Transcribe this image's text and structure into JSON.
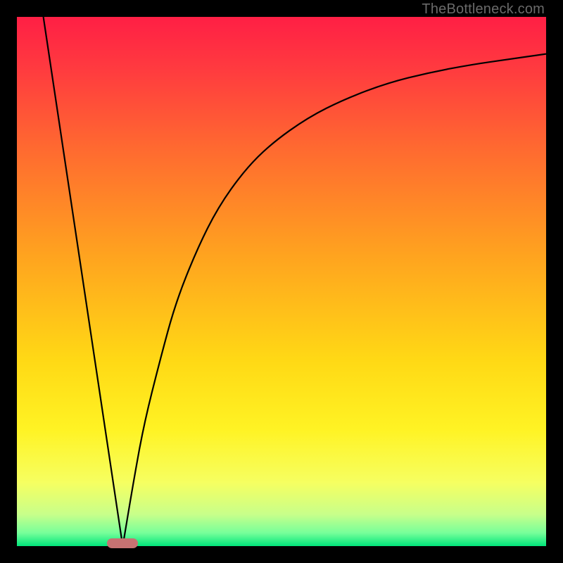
{
  "watermark": "TheBottleneck.com",
  "colors": {
    "frame": "#000000",
    "gradient_stops": [
      {
        "offset": 0.0,
        "color": "#ff1f45"
      },
      {
        "offset": 0.1,
        "color": "#ff3b3f"
      },
      {
        "offset": 0.25,
        "color": "#ff6a30"
      },
      {
        "offset": 0.45,
        "color": "#ffa31f"
      },
      {
        "offset": 0.65,
        "color": "#ffd915"
      },
      {
        "offset": 0.78,
        "color": "#fff324"
      },
      {
        "offset": 0.88,
        "color": "#f6ff61"
      },
      {
        "offset": 0.94,
        "color": "#c8ff8a"
      },
      {
        "offset": 0.975,
        "color": "#77ff9a"
      },
      {
        "offset": 1.0,
        "color": "#00e57a"
      }
    ],
    "curve": "#000000",
    "marker": "#c77272"
  },
  "chart_data": {
    "type": "line",
    "title": "",
    "xlabel": "",
    "ylabel": "",
    "xlim": [
      0,
      100
    ],
    "ylim": [
      0,
      100
    ],
    "grid": false,
    "legend": false,
    "series": [
      {
        "name": "left-line",
        "x": [
          5,
          20
        ],
        "values": [
          100,
          0
        ]
      },
      {
        "name": "right-curve",
        "x": [
          20,
          22,
          24,
          27,
          30,
          34,
          38,
          43,
          48,
          55,
          62,
          70,
          78,
          86,
          93,
          100
        ],
        "values": [
          0,
          12,
          23,
          35,
          46,
          56,
          64,
          71,
          76,
          81,
          84.5,
          87.5,
          89.5,
          91,
          92,
          93
        ]
      }
    ],
    "annotations": [
      {
        "name": "bottleneck-marker",
        "x": 20,
        "y": 0,
        "shape": "pill",
        "color": "#c77272"
      }
    ]
  }
}
